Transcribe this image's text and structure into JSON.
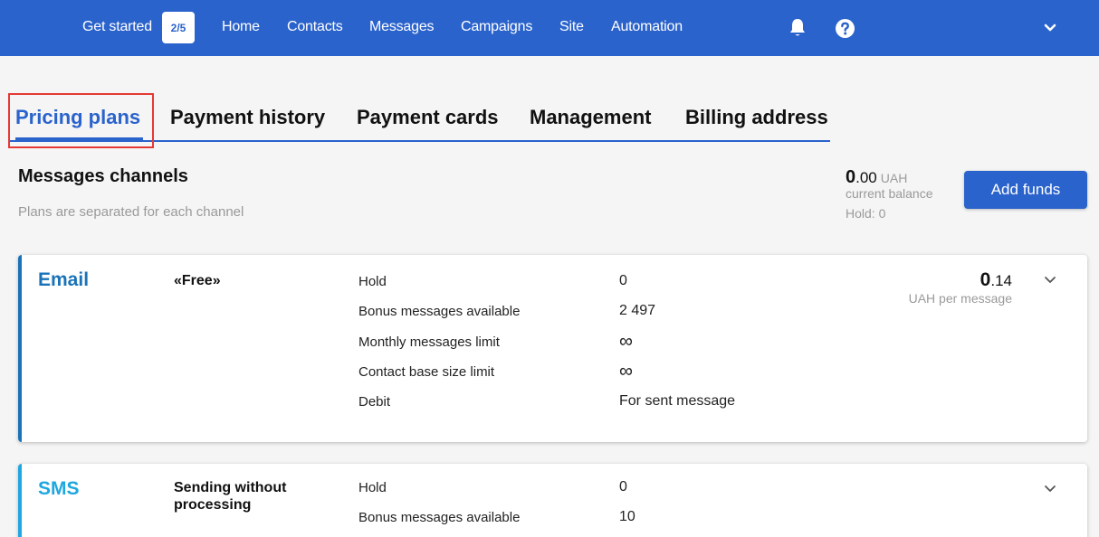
{
  "nav": {
    "get_started": "Get started",
    "progress_badge": "2/5",
    "items": [
      "Home",
      "Contacts",
      "Messages",
      "Campaigns",
      "Site",
      "Automation"
    ],
    "icons": [
      "bell-icon",
      "help-icon",
      "chevron-down-icon"
    ]
  },
  "tabs": [
    "Pricing plans",
    "Payment history",
    "Payment cards",
    "Management",
    "Billing address"
  ],
  "active_tab": "Pricing plans",
  "section": {
    "title": "Messages channels",
    "subtitle": "Plans are separated for each channel"
  },
  "balance": {
    "amount_int": "0",
    "amount_dec": ".00",
    "currency": "UAH",
    "label": "current balance",
    "hold": "Hold: 0"
  },
  "add_funds_label": "Add funds",
  "channels": [
    {
      "name": "Email",
      "color": "#1a73b8",
      "plan": "«Free»",
      "rows": [
        {
          "label": "Hold",
          "value": "0"
        },
        {
          "label": "Bonus messages available",
          "value": "2 497"
        },
        {
          "label": "Monthly messages limit",
          "value": "∞"
        },
        {
          "label": "Contact base size limit",
          "value": "∞"
        },
        {
          "label": "Debit",
          "value": "For sent message"
        }
      ],
      "price_int": "0",
      "price_dec": ".14",
      "price_label": "UAH per message"
    },
    {
      "name": "SMS",
      "color": "#1ea7e0",
      "plan": "Sending without processing",
      "rows": [
        {
          "label": "Hold",
          "value": "0"
        },
        {
          "label": "Bonus messages available",
          "value": "10"
        }
      ]
    }
  ],
  "colors": {
    "brand": "#2b63cc",
    "highlight": "#e53935"
  }
}
